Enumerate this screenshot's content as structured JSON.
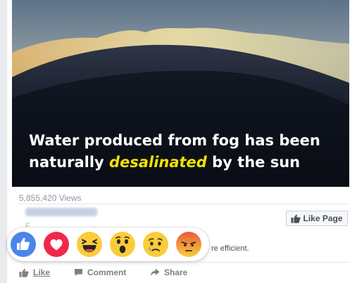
{
  "video": {
    "caption_before": "Water produced from fog has been naturally ",
    "caption_highlight": "desalinated",
    "caption_after": " by the sun"
  },
  "stats": {
    "views": "5,855,420 Views"
  },
  "page_button": {
    "label": "Like Page"
  },
  "comment": {
    "visible_text": "re efficient."
  },
  "reactions": [
    "like-icon",
    "love-icon",
    "haha-icon",
    "wow-icon",
    "sad-icon",
    "angry-icon"
  ],
  "actions": {
    "like": "Like",
    "comment": "Comment",
    "share": "Share"
  },
  "colors": {
    "like_blue": "#4a86e8",
    "love_red": "#f0284a",
    "emoji_yellow": "#fbcc3a",
    "angry_red": "#e95b3a",
    "highlight_yellow": "#f2e200"
  }
}
